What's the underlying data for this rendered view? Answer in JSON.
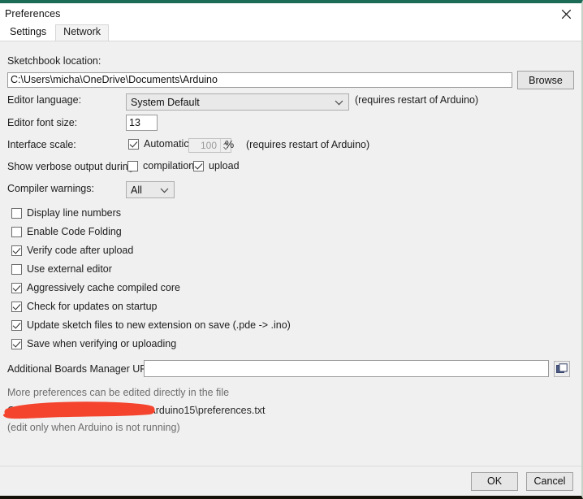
{
  "window": {
    "title": "Preferences",
    "close_icon": "close-icon",
    "accent_top": "#1c6b57",
    "bottom_border": "#141208"
  },
  "tabs": [
    {
      "label": "Settings",
      "active": true
    },
    {
      "label": "Network",
      "active": false
    }
  ],
  "settings": {
    "sketchbook": {
      "label": "Sketchbook location:",
      "value": "C:\\Users\\micha\\OneDrive\\Documents\\Arduino",
      "placeholder": "",
      "browse_label": "Browse"
    },
    "editor_language": {
      "label": "Editor language:",
      "value": "System Default",
      "hint": "(requires restart of Arduino)",
      "chevron_icon": "chevron-down-icon"
    },
    "editor_font_size": {
      "label": "Editor font size:",
      "value": "13"
    },
    "interface_scale": {
      "label": "Interface scale:",
      "automatic_label": "Automatic",
      "automatic_checked": true,
      "scale_value": "100",
      "percent_label": "%",
      "hint": "(requires restart of Arduino)"
    },
    "verbose_output": {
      "label": "Show verbose output during:",
      "compilation_label": "compilation",
      "compilation_checked": false,
      "upload_label": "upload",
      "upload_checked": true
    },
    "compiler_warnings": {
      "label": "Compiler warnings:",
      "value": "All",
      "chevron_icon": "chevron-down-icon"
    },
    "checkboxes": [
      {
        "label": "Display line numbers",
        "checked": false
      },
      {
        "label": "Enable Code Folding",
        "checked": false
      },
      {
        "label": "Verify code after upload",
        "checked": true
      },
      {
        "label": "Use external editor",
        "checked": false
      },
      {
        "label": "Aggressively cache compiled core",
        "checked": true
      },
      {
        "label": "Check for updates on startup",
        "checked": true
      },
      {
        "label": "Update sketch files to new extension on save (.pde -> .ino)",
        "checked": true
      },
      {
        "label": "Save when verifying or uploading",
        "checked": true
      }
    ],
    "boards_urls": {
      "label": "Additional Boards Manager URLs:",
      "value": "",
      "placeholder": "",
      "icon": "open-window-icon"
    },
    "footer": {
      "line1": "More preferences can be edited directly in the file",
      "line2": "C:\\Users\\micha\\AppData\\Local\\Arduino15\\preferences.txt",
      "line3": "(edit only when Arduino is not running)"
    }
  },
  "buttons": {
    "ok": "OK",
    "cancel": "Cancel"
  },
  "annotation": {
    "type": "red-underline-stroke",
    "color": "#f4442e"
  }
}
